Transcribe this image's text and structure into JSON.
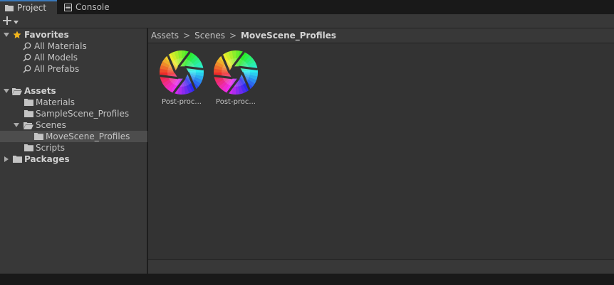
{
  "tabs": [
    {
      "label": "Project",
      "icon": "folder-icon",
      "active": true
    },
    {
      "label": "Console",
      "icon": "console-icon",
      "active": false
    }
  ],
  "toolbar": {
    "add_label": "+",
    "add_icon": "plus-icon"
  },
  "tree": {
    "favorites": {
      "label": "Favorites",
      "items": [
        "All Materials",
        "All Models",
        "All Prefabs"
      ]
    },
    "assets": {
      "label": "Assets",
      "children": {
        "materials": "Materials",
        "sample_scene_profiles": "SampleScene_Profiles",
        "scenes": "Scenes",
        "move_scene_profiles": "MoveScene_Profiles",
        "scripts": "Scripts"
      }
    },
    "packages": {
      "label": "Packages"
    }
  },
  "breadcrumb": {
    "items": [
      "Assets",
      "Scenes"
    ],
    "current": "MoveScene_Profiles",
    "separator": ">"
  },
  "assets_grid": [
    {
      "name": "Post-proc...",
      "icon": "post-processing-profile-icon"
    },
    {
      "name": "Post-proc...",
      "icon": "post-processing-profile-icon"
    }
  ],
  "colors": {
    "accent": "#3a79bb",
    "selection": "#4d4d4d",
    "panel": "#383838",
    "grid_bg": "#333333",
    "star": "#f2b51c"
  }
}
